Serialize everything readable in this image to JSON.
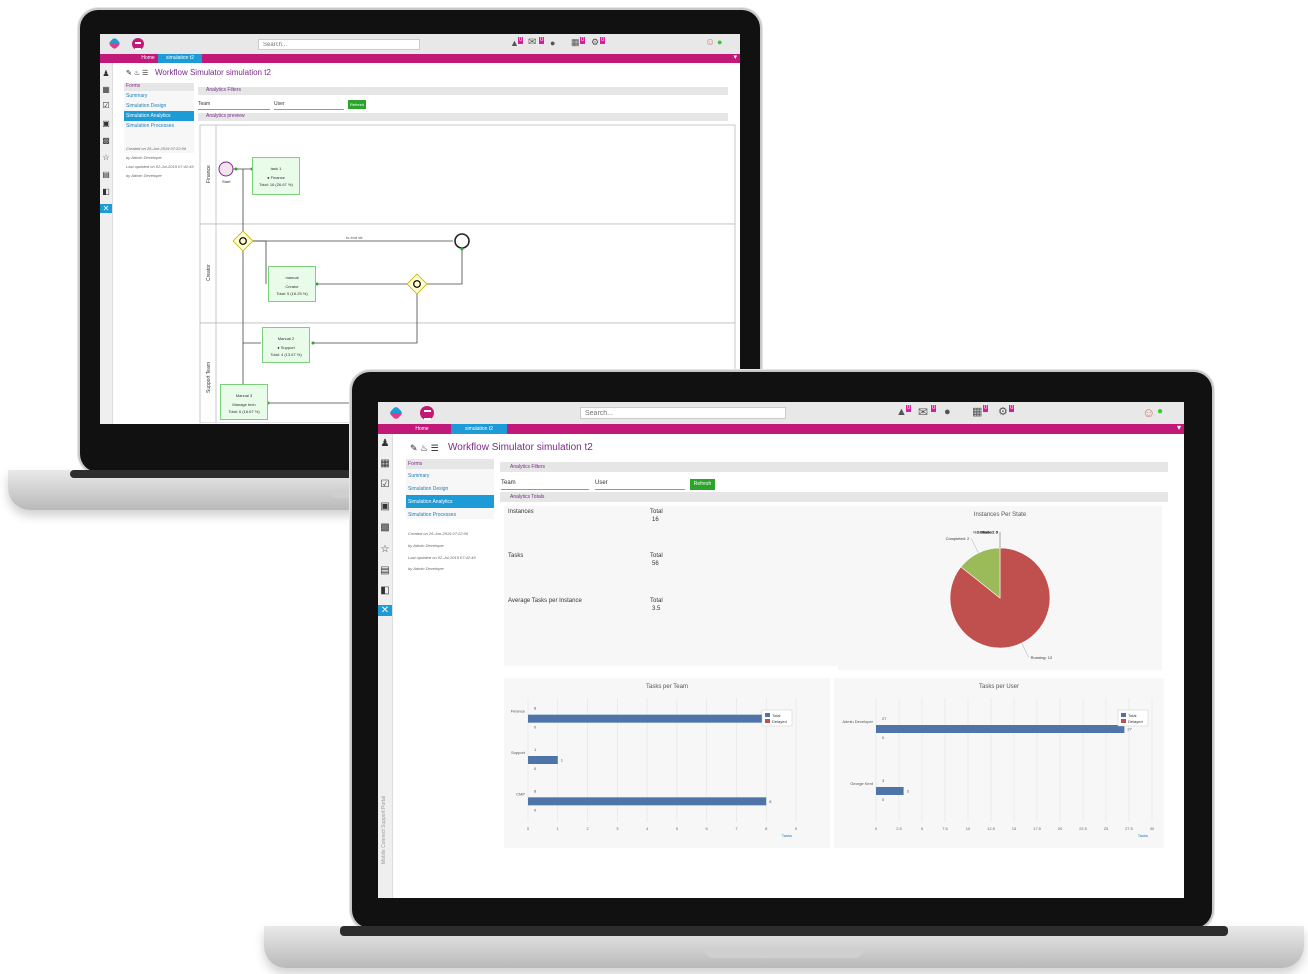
{
  "app": {
    "search_placeholder": "Search...",
    "tabs": [
      "Home",
      "simulation t2"
    ],
    "badge_counts": [
      "0",
      "0",
      "0",
      "0"
    ]
  },
  "back": {
    "page_title": "Workflow Simulator simulation t2",
    "nav": {
      "header": "Forms",
      "items": [
        "Summary",
        "Simulation Design",
        "Simulation Analytics",
        "Simulation Processes"
      ],
      "selected": 2
    },
    "meta": [
      "Created on 26-Jun-2019 07:22:06",
      "by Admin Developer",
      "Last updated on 02-Jul-2019 07:42:49",
      "by Admin Developer"
    ],
    "sections": {
      "filters": "Analytics Filters",
      "preview": "Analytics preview"
    },
    "filters": {
      "team": "Team",
      "user": "User",
      "refresh": "Refresh"
    },
    "lanes": [
      "Finance",
      "Creator",
      "Support Team"
    ],
    "tasks": [
      {
        "title": "task 1",
        "sub": "● Finance",
        "total": "Total: 16 (26.67 %)"
      },
      {
        "title": "manual",
        "sub": "Creator",
        "total": "Total: 5 (16.25 %)"
      },
      {
        "title": "Manual 2",
        "sub": "● Support",
        "total": "Total: 4 (13.67 %)"
      },
      {
        "title": "Manual 3",
        "sub": "Manage tech",
        "total": "Total: 6 (16.67 %)"
      }
    ],
    "flow_label": "to end de",
    "start_label": "Start"
  },
  "front": {
    "page_title": "Workflow Simulator simulation t2",
    "nav": {
      "header": "Forms",
      "items": [
        "Summary",
        "Simulation Design",
        "Simulation Analytics",
        "Simulation Processes"
      ],
      "selected": 2
    },
    "meta": [
      "Created on 26-Jun-2019 07:22:06",
      "by Admin Developer",
      "Last updated on 02-Jul-2019 07:42:49",
      "by Admin Developer"
    ],
    "sections": {
      "filters": "Analytics Filters",
      "totals": "Analytics Totals"
    },
    "filters": {
      "team": "Team",
      "user": "User",
      "refresh": "Refresh"
    },
    "totals": [
      {
        "label": "Instances",
        "head": "Total",
        "value": "16"
      },
      {
        "label": "Tasks",
        "head": "Total",
        "value": "56"
      },
      {
        "label": "Average Tasks per Instance",
        "head": "Total",
        "value": "3.5"
      }
    ],
    "sidebar_vertical": "Mobile Connect Support Portal"
  },
  "chart_data": [
    {
      "type": "pie",
      "title": "Instances Per State",
      "categories": [
        "Running",
        "Completed",
        "Canceled",
        "Paused",
        "Failed",
        "Not Started"
      ],
      "values": [
        12,
        2,
        0,
        0,
        0,
        0
      ],
      "colors": [
        "#c0504d",
        "#9bbb59",
        "#8064a2",
        "#4bacc6",
        "#f79646",
        "#4f81bd"
      ]
    },
    {
      "type": "bar",
      "title": "Tasks per Team",
      "orientation": "horizontal",
      "categories": [
        "Finance",
        "Support",
        "CMP"
      ],
      "series": [
        {
          "name": "Total",
          "values": [
            8,
            1,
            8
          ]
        },
        {
          "name": "Delayed",
          "values": [
            0,
            0,
            0
          ]
        }
      ],
      "xlim": [
        0,
        9
      ],
      "xticks": [
        "0",
        "1",
        "2",
        "3",
        "4",
        "5",
        "6",
        "7",
        "8",
        "9"
      ],
      "xlabel": "Tasks"
    },
    {
      "type": "bar",
      "title": "Tasks per User",
      "orientation": "horizontal",
      "categories": [
        "Admin Developer",
        "George Kent"
      ],
      "series": [
        {
          "name": "Total",
          "values": [
            27,
            3
          ]
        },
        {
          "name": "Delayed",
          "values": [
            0,
            0
          ]
        }
      ],
      "xlim": [
        0,
        30
      ],
      "xticks": [
        "0",
        "2.5",
        "5",
        "7.5",
        "10",
        "12.5",
        "15",
        "17.5",
        "20",
        "22.5",
        "25",
        "27.5",
        "30"
      ],
      "xlabel": "Tasks"
    }
  ]
}
